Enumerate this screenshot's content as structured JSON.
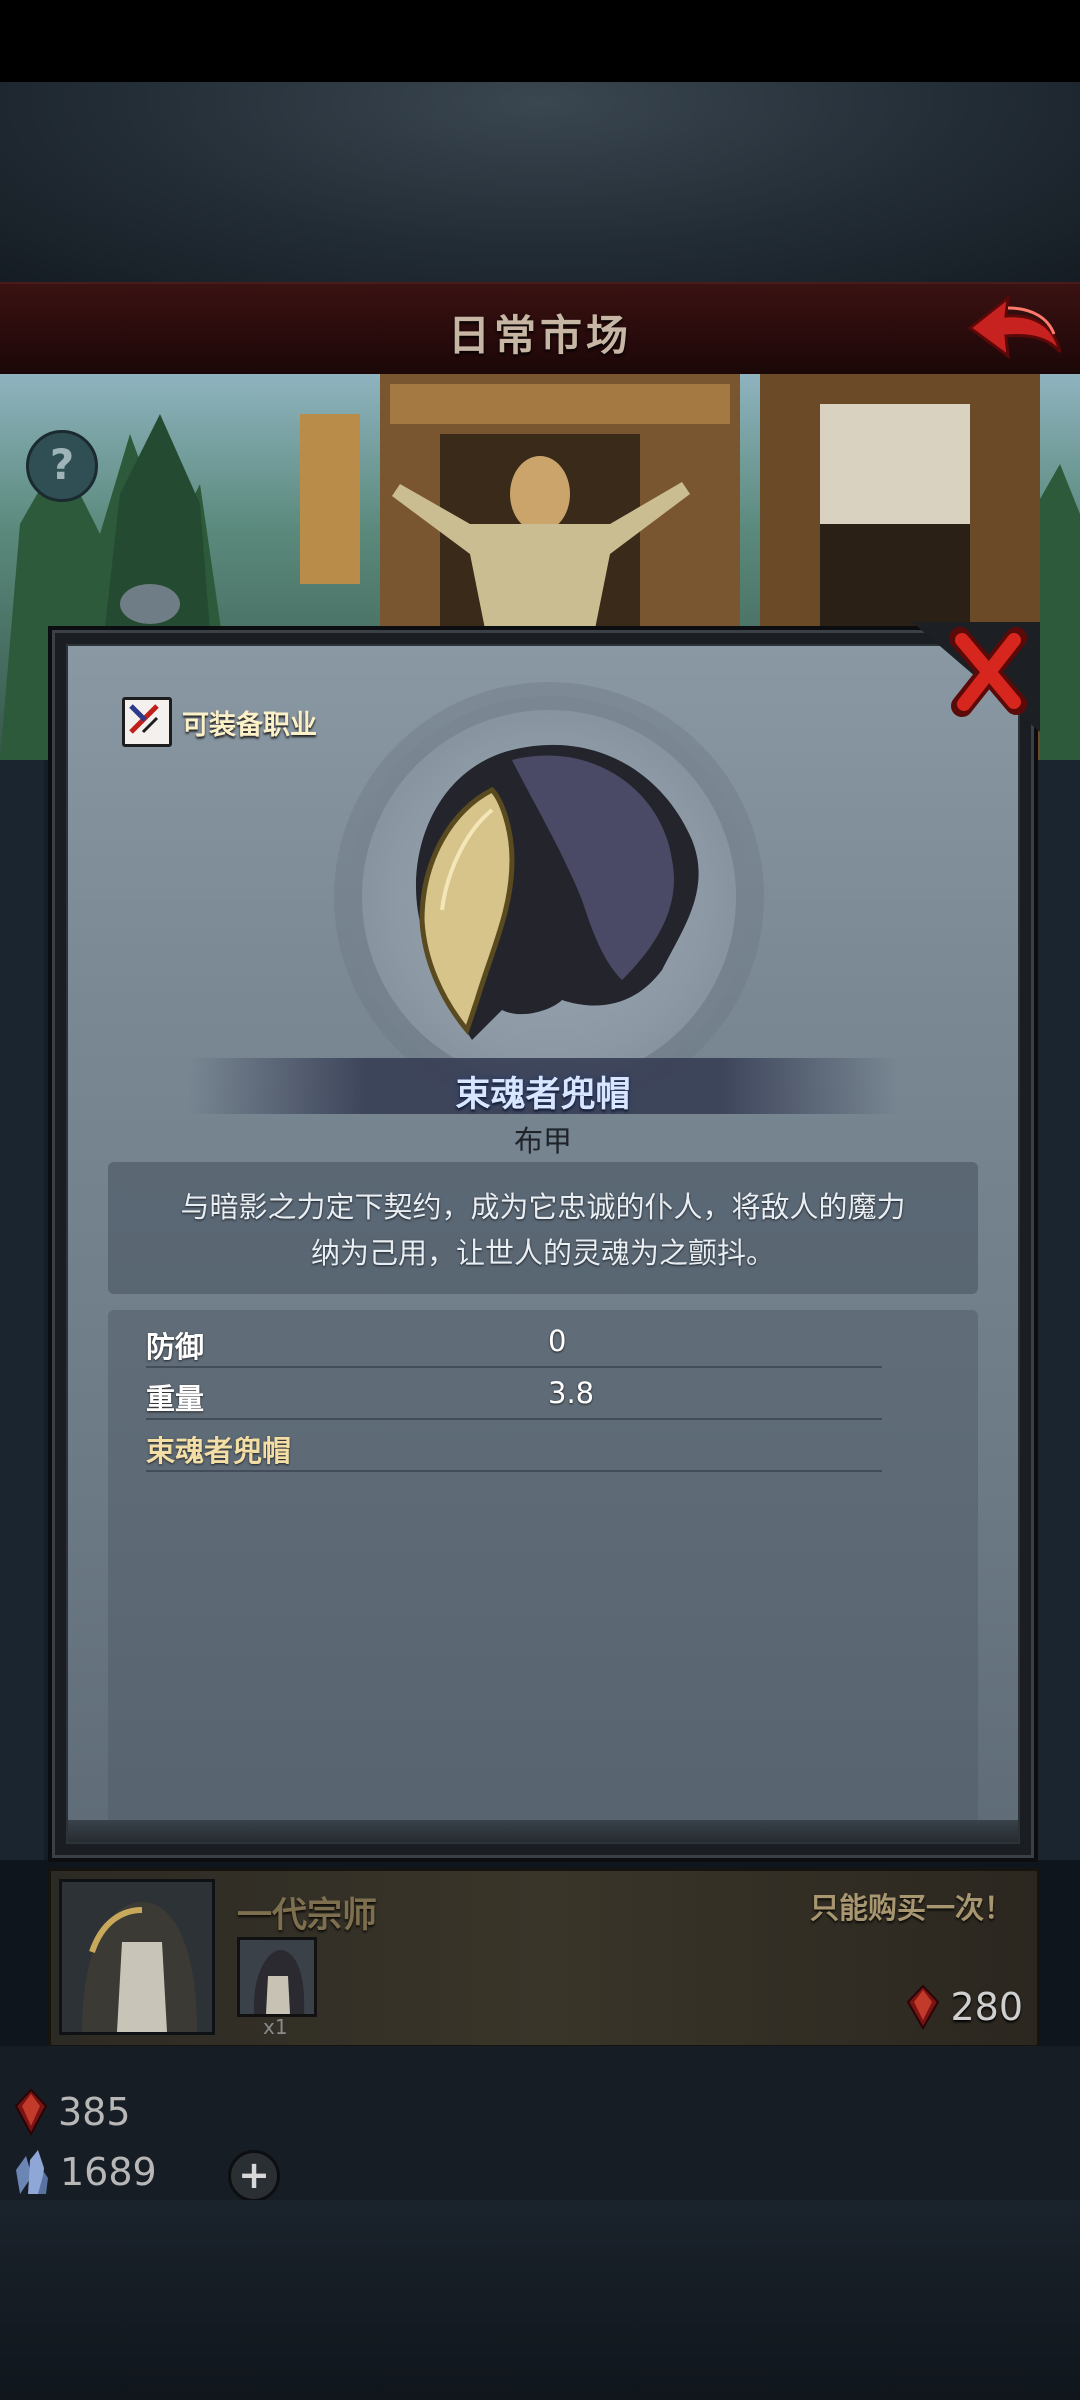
{
  "header": {
    "title": "日常市场"
  },
  "dialog": {
    "class_tag": "可装备职业",
    "item_name": "束魂者兜帽",
    "item_type": "布甲",
    "description_lines": [
      "与暗影之力定下契约，成为它忠诚的仆人，将敌人的魔力",
      "纳为己用，让世人的灵魂为之颤抖。"
    ],
    "stats": [
      {
        "label": "防御",
        "value": "0"
      },
      {
        "label": "重量",
        "value": "3.8"
      }
    ],
    "set_name": "束魂者兜帽"
  },
  "offer": {
    "title": "一代宗师",
    "limit": "只能购买一次！",
    "quantity": "x1",
    "price": "280"
  },
  "currency": {
    "ruby": "385",
    "crystal": "1689"
  },
  "icons": {
    "back": "back-arrow-icon",
    "close": "close-icon",
    "help": "help-icon",
    "ruby": "ruby-gem-icon",
    "crystal": "crystal-icon",
    "add": "plus-icon"
  },
  "colors": {
    "header": "#2a0b0c",
    "accent_red": "#c0201c",
    "item_name": "#d9e6ff",
    "set_name": "#f3dfa6"
  }
}
